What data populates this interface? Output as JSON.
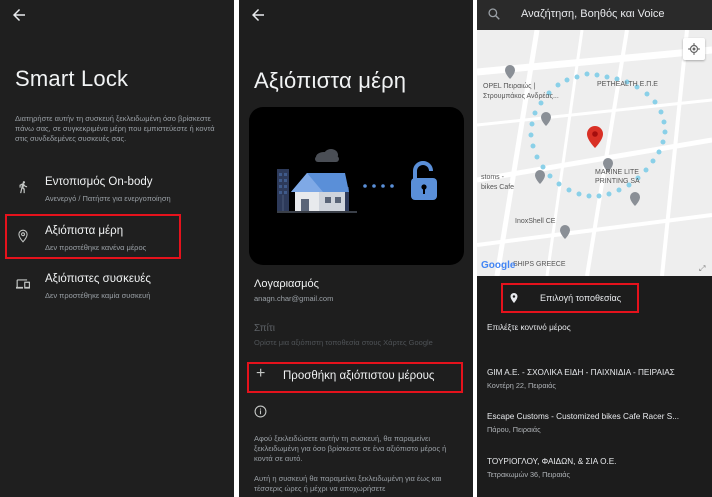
{
  "panel1": {
    "title": "Smart Lock",
    "description": "Διατηρήστε αυτήν τη συσκευή ξεκλειδωμένη όσο βρίσκεστε πάνω σας, σε συγκεκριμένα μέρη που εμπιστεύεστε ή κοντά στις συνδεδεμένες συσκευές σας.",
    "items": [
      {
        "label": "Εντοπισμός On-body",
        "sub": "Ανενεργό / Πατήστε για ενεργοποίηση",
        "icon": "walking-person-icon"
      },
      {
        "label": "Αξιόπιστα μέρη",
        "sub": "Δεν προστέθηκε κανένα μέρος",
        "icon": "location-pin-icon"
      },
      {
        "label": "Αξιόπιστες συσκευές",
        "sub": "Δεν προστέθηκε καμία συσκευή",
        "icon": "devices-icon"
      }
    ]
  },
  "panel2": {
    "title": "Αξιόπιστα μέρη",
    "account_label": "Λογαριασμός",
    "account_email": "anagn.char@gmail.com",
    "home_label": "Σπίτι",
    "home_sub": "Ορίστε μια αξιόπιστη τοποθεσία στους Χάρτες Google",
    "add_label": "Προσθήκη αξιόπιστου μέρους",
    "info_text_1": "Αφού ξεκλειδώσετε αυτήν τη συσκευή, θα παραμείνει ξεκλειδωμένη για όσο βρίσκεστε σε ένα αξιόπιστο μέρος ή κοντά σε αυτό.",
    "info_text_2": "Αυτή η συσκευή θα παραμείνει ξεκλειδωμένη για έως και τέσσερις ώρες ή μέχρι να αποχωρήσετε"
  },
  "panel3": {
    "search_title": "Αναζήτηση, Βοηθός και Voice",
    "map_labels": {
      "opel": "OPEL Πειραιώς |",
      "opel2": "Στρουμπάκος Ανδρέας...",
      "pethealth": "PETHEALTH Ε.Π.Ε",
      "marine": "MARINE LITE",
      "marine2": "PRINTING SA",
      "escape": "stoms -",
      "escape2": "bikes Cafe",
      "inox": "InoxShell CE",
      "ships": "SHIPS GREECE",
      "google": "Google"
    },
    "select_location": "Επιλογή τοποθεσίας",
    "nearby_label": "Επιλέξτε κοντινό μέρος",
    "places": [
      {
        "name": "GIM A.E. - ΣΧΟΛΙΚΑ ΕΙΔΗ - ΠΑΙΧΝΙΔΙΑ - ΠΕΙΡΑΙΑΣ",
        "address": "Κοντέρη 22, Πειραιάς"
      },
      {
        "name": "Escape Customs - Customized bikes Cafe Racer S...",
        "address": "Πάρου, Πειραιάς"
      },
      {
        "name": "ΤΟΥΡΙΟΓΛΟΥ, ΦΑΙΔΩΝ, & ΣΙΑ Ο.Ε.",
        "address": "Τετρακωμών 36, Πειραιάς"
      }
    ]
  },
  "colors": {
    "highlight": "#e5121c",
    "lock_blue": "#5a8fd8",
    "pin_red": "#d93025"
  }
}
